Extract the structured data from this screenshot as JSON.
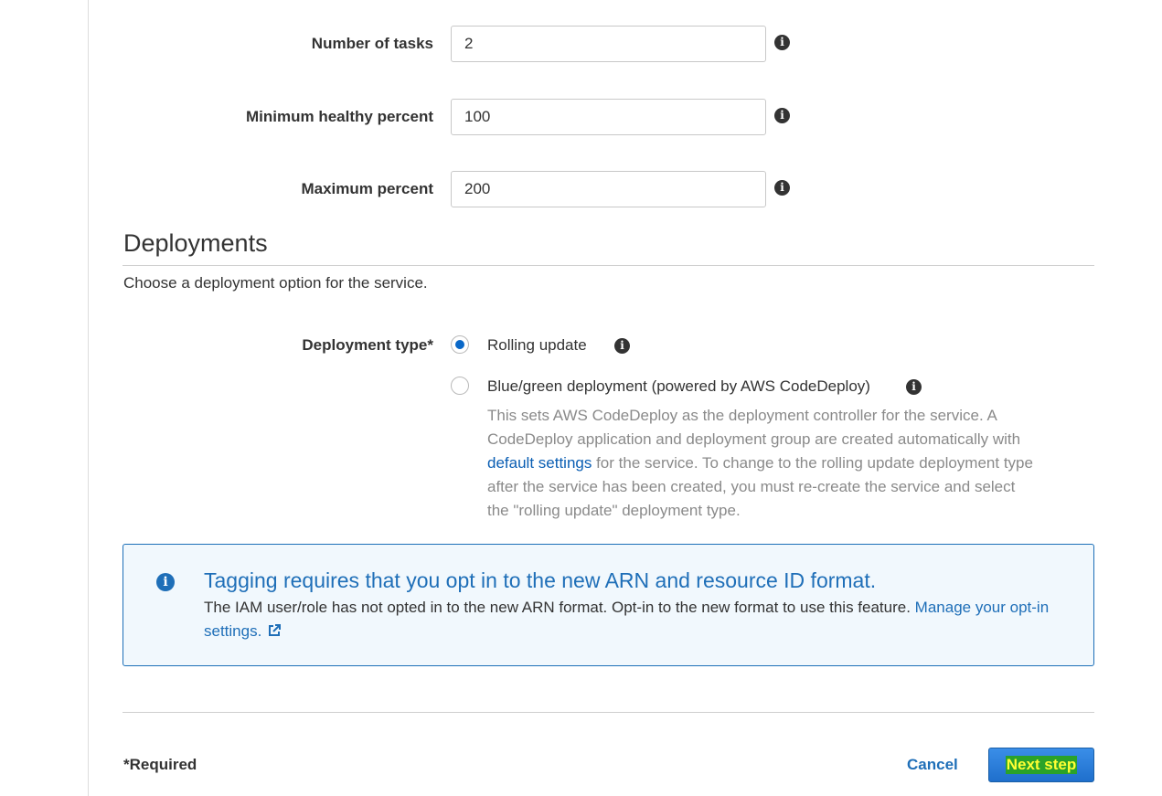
{
  "form": {
    "number_of_tasks": {
      "label": "Number of tasks",
      "value": "2"
    },
    "minimum_healthy_percent": {
      "label": "Minimum healthy percent",
      "value": "100"
    },
    "maximum_percent": {
      "label": "Maximum percent",
      "value": "200"
    }
  },
  "deployments": {
    "title": "Deployments",
    "description": "Choose a deployment option for the service.",
    "type_label": "Deployment type*",
    "options": [
      {
        "label": "Rolling update",
        "selected": true
      },
      {
        "label": "Blue/green deployment (powered by AWS CodeDeploy)",
        "selected": false
      }
    ],
    "help_prefix": "This sets AWS CodeDeploy as the deployment controller for the service. A CodeDeploy application and deployment group are created automatically with ",
    "help_link": "default settings",
    "help_suffix": " for the service. To change to the rolling update deployment type after the service has been created, you must re-create the service and select the \"rolling update\" deployment type."
  },
  "alert": {
    "title": "Tagging requires that you opt in to the new ARN and resource ID format.",
    "body": "The IAM user/role has not opted in to the new ARN format. Opt-in to the new format to use this feature. ",
    "link": "Manage your opt-in settings."
  },
  "footer": {
    "required_note": "*Required",
    "cancel_label": "Cancel",
    "next_label": "Next step"
  },
  "colors": {
    "accent": "#1f6fb8",
    "radio_selected": "#0a68c8",
    "alert_bg": "#f1f8fd",
    "next_highlight_bg": "#2aa22a",
    "next_highlight_text": "#ffff33"
  }
}
